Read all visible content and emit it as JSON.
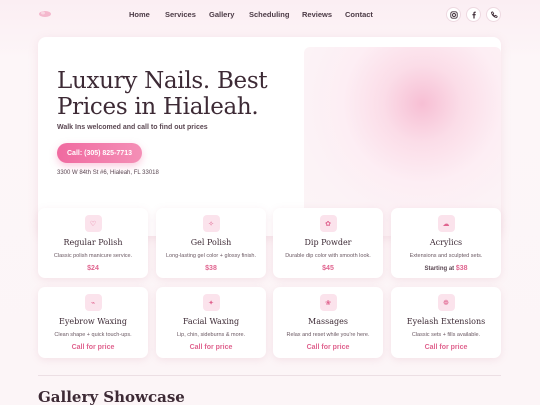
{
  "nav": {
    "logo_icon": "nail-logo-icon",
    "items": [
      "Home",
      "Services",
      "Gallery",
      "Scheduling",
      "Reviews",
      "Contact"
    ]
  },
  "social": {
    "icons": [
      "instagram-icon",
      "facebook-icon",
      "phone-icon"
    ]
  },
  "hero": {
    "title": "Luxury Nails. Best Prices in Hialeah.",
    "subtitle": "Walk Ins welcomed and call to find out prices",
    "call_button": "Call: (305) 825-7713",
    "address": "3300 W 84th St #6, Hialeah, FL 33018"
  },
  "services": [
    {
      "icon": "heart-icon",
      "glyph": "♡",
      "name": "Regular Polish",
      "desc": "Classic polish manicure service.",
      "price_prefix": "",
      "price": "$24"
    },
    {
      "icon": "sparkle-icon",
      "glyph": "✧",
      "name": "Gel Polish",
      "desc": "Long-lasting gel color + glossy finish.",
      "price_prefix": "",
      "price": "$38"
    },
    {
      "icon": "flower-icon",
      "glyph": "✿",
      "name": "Dip Powder",
      "desc": "Durable dip color with smooth look.",
      "price_prefix": "",
      "price": "$45"
    },
    {
      "icon": "cloud-icon",
      "glyph": "☁",
      "name": "Acrylics",
      "desc": "Extensions and sculpted sets.",
      "price_prefix": "Starting at ",
      "price": "$38"
    },
    {
      "icon": "wax-icon",
      "glyph": "⌁",
      "name": "Eyebrow Waxing",
      "desc": "Clean shape + quick touch-ups.",
      "price_prefix": "",
      "price": "Call for price"
    },
    {
      "icon": "plus-icon",
      "glyph": "✦",
      "name": "Facial Waxing",
      "desc": "Lip, chin, sideburns & more.",
      "price_prefix": "",
      "price": "Call for price"
    },
    {
      "icon": "lotus-icon",
      "glyph": "❀",
      "name": "Massages",
      "desc": "Relax and reset while you're here.",
      "price_prefix": "",
      "price": "Call for price"
    },
    {
      "icon": "eye-icon",
      "glyph": "❁",
      "name": "Eyelash Extensions",
      "desc": "Classic sets + fills available.",
      "price_prefix": "",
      "price": "Call for price"
    }
  ],
  "gallery": {
    "title": "Gallery Showcase"
  },
  "colors": {
    "accent": "#e0648f",
    "button": "#f06aa0",
    "heading": "#3d2a35"
  }
}
